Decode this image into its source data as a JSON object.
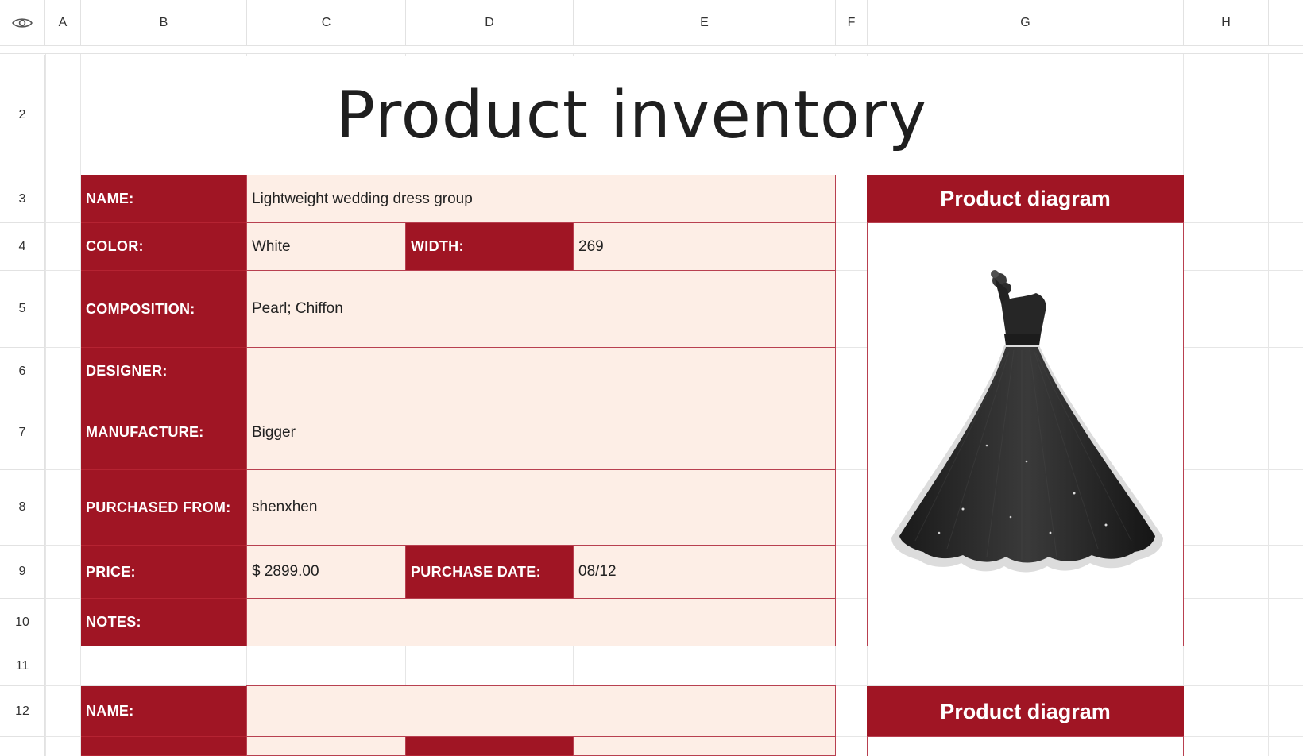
{
  "columns": [
    "A",
    "B",
    "C",
    "D",
    "E",
    "F",
    "G",
    "H"
  ],
  "rows": [
    "2",
    "3",
    "4",
    "5",
    "6",
    "7",
    "8",
    "9",
    "10",
    "11",
    "12"
  ],
  "title": "Product inventory",
  "labels": {
    "name": "NAME:",
    "color": "COLOR:",
    "width": "WIDTH:",
    "composition": "COMPOSITION:",
    "designer": "DESIGNER:",
    "manufacture": "MANUFACTURE:",
    "purchased_from": "PURCHASED FROM:",
    "price": "PRICE:",
    "purchase_date": "PURCHASE DATE:",
    "notes": "NOTES:"
  },
  "product1": {
    "name": "Lightweight wedding dress group",
    "color": "White",
    "width": "269",
    "composition": "Pearl; Chiffon",
    "designer": "",
    "manufacture": "Bigger",
    "purchased_from": "shenxhen",
    "price": "$ 2899.00",
    "purchase_date": "08/12",
    "notes": ""
  },
  "product2": {
    "name": ""
  },
  "diagram_title": "Product diagram",
  "colors": {
    "label_bg": "#a01524",
    "value_bg": "#fdeee6",
    "border": "#b84050"
  },
  "icons": {
    "visibility": "eye-icon"
  }
}
